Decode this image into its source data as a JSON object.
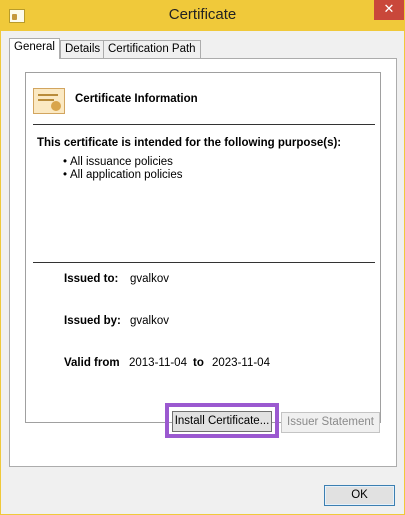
{
  "window": {
    "title": "Certificate",
    "close_glyph": "✕"
  },
  "tabs": [
    {
      "label": "General",
      "active": true
    },
    {
      "label": "Details",
      "active": false
    },
    {
      "label": "Certification Path",
      "active": false
    }
  ],
  "info": {
    "heading": "Certificate Information",
    "purpose_heading": "This certificate is intended for the following purpose(s):",
    "policies": [
      "All issuance policies",
      "All application policies"
    ],
    "issued_to_label": "Issued to:",
    "issued_to_value": "gvalkov",
    "issued_by_label": "Issued by:",
    "issued_by_value": "gvalkov",
    "valid_from_label": "Valid from",
    "valid_from_value": "2013-11-04",
    "valid_to_label": "to",
    "valid_to_value": "2023-11-04"
  },
  "buttons": {
    "install_label": "Install Certificate...",
    "issuer_label": "Issuer Statement",
    "ok_label": "OK"
  },
  "icons": {
    "window": "certificate-icon",
    "info": "certificate-icon",
    "close": "close-icon"
  },
  "colors": {
    "title_bar": "#f0c93a",
    "close_button": "#c9473a",
    "highlight": "#9b59d0"
  }
}
